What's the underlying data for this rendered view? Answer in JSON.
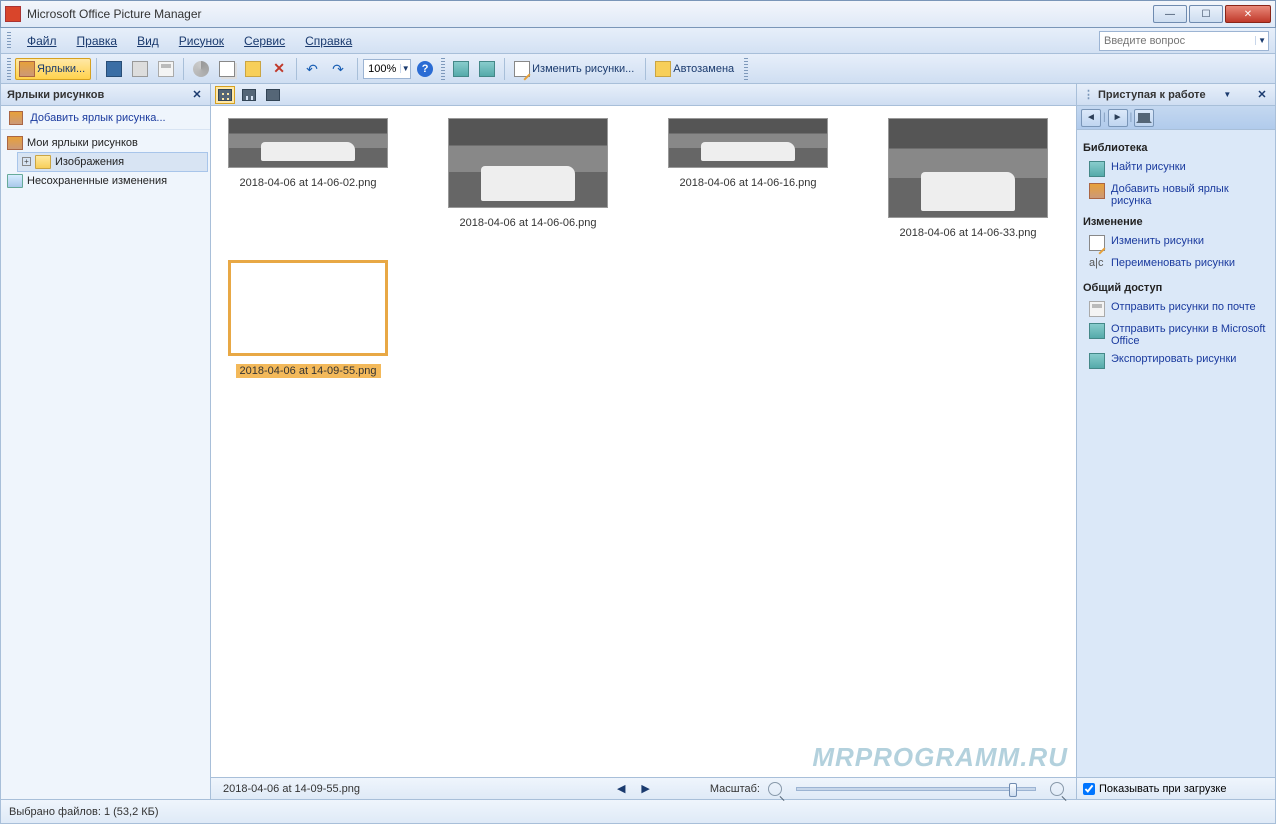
{
  "window": {
    "title": "Microsoft Office Picture Manager"
  },
  "menu": {
    "file": "Файл",
    "edit": "Правка",
    "view": "Вид",
    "picture": "Рисунок",
    "tools": "Сервис",
    "help": "Справка"
  },
  "search": {
    "placeholder": "Введите вопрос"
  },
  "toolbar": {
    "shortcuts": "Ярлыки...",
    "zoom": "100%",
    "edit_pictures": "Изменить рисунки...",
    "auto_correct": "Автозамена"
  },
  "left_panel": {
    "title": "Ярлыки рисунков",
    "add_shortcut": "Добавить ярлык рисунка...",
    "my_shortcuts": "Мои ярлыки рисунков",
    "images_folder": "Изображения",
    "unsaved": "Несохраненные изменения"
  },
  "thumbs": [
    {
      "name": "2018-04-06 at 14-06-02.png",
      "selected": false
    },
    {
      "name": "2018-04-06 at 14-06-06.png",
      "selected": false
    },
    {
      "name": "2018-04-06 at 14-06-16.png",
      "selected": false
    },
    {
      "name": "2018-04-06 at 14-06-33.png",
      "selected": false
    },
    {
      "name": "2018-04-06 at 14-09-55.png",
      "selected": true
    }
  ],
  "center_status": {
    "current": "2018-04-06 at 14-09-55.png",
    "zoom_label": "Масштаб:"
  },
  "task_pane": {
    "title": "Приступая к работе",
    "groups": {
      "library": {
        "title": "Библиотека",
        "find": "Найти рисунки",
        "add": "Добавить новый ярлык рисунка"
      },
      "edit": {
        "title": "Изменение",
        "edit": "Изменить рисунки",
        "rename": "Переименовать рисунки"
      },
      "share": {
        "title": "Общий доступ",
        "mail": "Отправить рисунки по почте",
        "office": "Отправить рисунки в Microsoft Office",
        "export": "Экспортировать рисунки"
      }
    },
    "show_on_start": "Показывать при загрузке"
  },
  "statusbar": {
    "text": "Выбрано файлов: 1 (53,2 КБ)"
  },
  "watermark": "MRPROGRAMM.RU"
}
